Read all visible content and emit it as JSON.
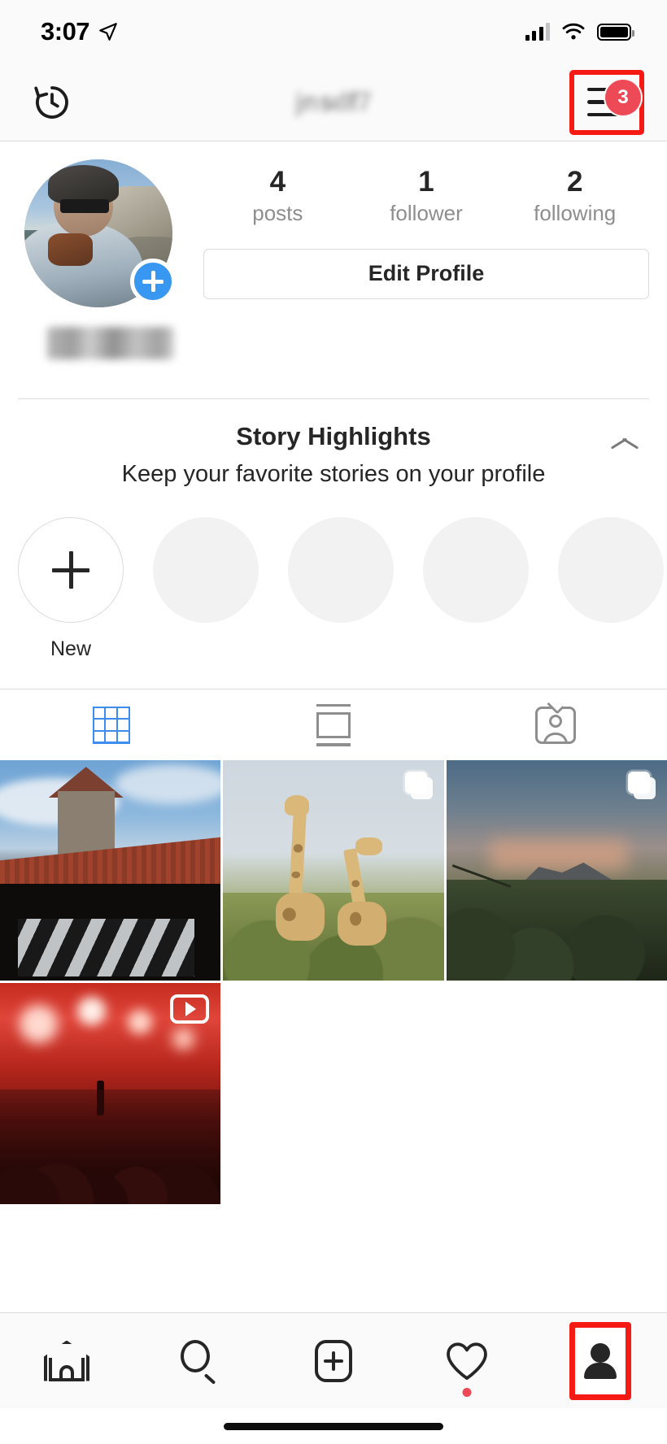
{
  "status_bar": {
    "time": "3:07",
    "location_icon": "location-arrow-icon",
    "cellular_icon": "cellular-bars-icon",
    "wifi_icon": "wifi-icon",
    "battery_icon": "battery-icon"
  },
  "top_nav": {
    "archive_icon": "clock-history-icon",
    "username": "jnsdf7",
    "username_blurred": true,
    "menu_icon": "hamburger-menu-icon",
    "menu_badge_count": "3",
    "menu_highlighted": true,
    "highlight_color": "#f61a14",
    "badge_color": "#ed4956"
  },
  "profile": {
    "avatar_name": "profile-avatar",
    "add_story_icon": "plus-icon",
    "add_story_color": "#3897f0",
    "bio_name_blurred": true,
    "stats": [
      {
        "value": "4",
        "label": "posts"
      },
      {
        "value": "1",
        "label": "follower"
      },
      {
        "value": "2",
        "label": "following"
      }
    ],
    "edit_profile_label": "Edit Profile"
  },
  "story_highlights": {
    "title": "Story Highlights",
    "subtitle": "Keep your favorite stories on your profile",
    "collapse_icon": "chevron-up-icon",
    "new_label": "New",
    "new_icon": "plus-icon",
    "placeholder_count": 4
  },
  "content_tabs": [
    {
      "name": "grid-tab",
      "icon": "grid-icon",
      "active": true,
      "active_color": "#3e8ced"
    },
    {
      "name": "feed-tab",
      "icon": "feed-list-icon",
      "active": false
    },
    {
      "name": "tagged-tab",
      "icon": "tagged-person-icon",
      "active": false
    }
  ],
  "posts": [
    {
      "name": "post-castle",
      "type": "photo",
      "badge": "none"
    },
    {
      "name": "post-giraffes",
      "type": "carousel",
      "badge": "multi-photo-icon"
    },
    {
      "name": "post-savanna",
      "type": "carousel",
      "badge": "multi-photo-icon"
    },
    {
      "name": "post-concert",
      "type": "video",
      "badge": "video-icon"
    }
  ],
  "bottom_nav": [
    {
      "name": "nav-home",
      "icon": "home-icon",
      "active": false,
      "dot": false
    },
    {
      "name": "nav-search",
      "icon": "search-icon",
      "active": false,
      "dot": false
    },
    {
      "name": "nav-add-post",
      "icon": "plus-square-icon",
      "active": false,
      "dot": false
    },
    {
      "name": "nav-activity",
      "icon": "heart-icon",
      "active": false,
      "dot": true
    },
    {
      "name": "nav-profile",
      "icon": "person-icon",
      "active": true,
      "dot": false,
      "highlighted": true
    }
  ],
  "home_indicator": "home-bar"
}
